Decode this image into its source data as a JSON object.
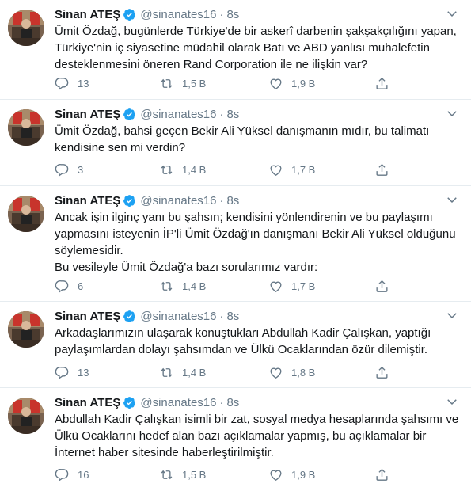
{
  "author": {
    "name": "Sinan ATEŞ",
    "handle": "@sinanates16",
    "dot": "·",
    "time": "8s"
  },
  "tweets": [
    {
      "lines": [
        "Ümit Özdağ, bugünlerde Türkiye'de bir askerî darbenin şakşakçılığını yapan,",
        "Türkiye'nin iç siyasetine müdahil olarak Batı ve ABD yanlısı muhalefetin",
        "desteklenmesini öneren Rand Corporation ile ne ilişkin var?"
      ],
      "replies": "13",
      "retweets": "1,5 B",
      "likes": "1,9 B"
    },
    {
      "lines": [
        "Ümit Özdağ, bahsi geçen Bekir Ali Yüksel danışmanın mıdır, bu talimatı",
        "kendisine sen mi verdin?"
      ],
      "replies": "3",
      "retweets": "1,4 B",
      "likes": "1,7 B"
    },
    {
      "lines": [
        "Ancak işin ilginç yanı bu şahsın; kendisini yönlendirenin ve bu paylaşımı",
        "yapmasını isteyenin İP'li Ümit Özdağ'ın danışmanı Bekir Ali Yüksel olduğunu",
        "söylemesidir.",
        "Bu vesileyle Ümit Özdağ'a bazı sorularımız vardır:"
      ],
      "replies": "6",
      "retweets": "1,4 B",
      "likes": "1,7 B"
    },
    {
      "lines": [
        "Arkadaşlarımızın ulaşarak konuştukları Abdullah Kadir Çalışkan, yaptığı",
        "paylaşımlardan dolayı şahsımdan ve Ülkü Ocaklarından özür dilemiştir."
      ],
      "replies": "13",
      "retweets": "1,4 B",
      "likes": "1,8 B"
    },
    {
      "lines": [
        "Abdullah Kadir Çalışkan isimli bir zat, sosyal medya hesaplarında şahsımı ve",
        "Ülkü Ocaklarını hedef alan bazı açıklamalar yapmış, bu açıklamalar bir",
        "İnternet haber sitesinde haberleştirilmiştir."
      ],
      "replies": "16",
      "retweets": "1,5 B",
      "likes": "1,9 B"
    }
  ],
  "colors": {
    "name": "#14171a",
    "meta": "#657786",
    "verified": "#1da1f2",
    "divider": "#e6ecf0"
  },
  "icons": [
    "verified-badge-icon",
    "chevron-down-icon",
    "reply-icon",
    "retweet-icon",
    "like-icon",
    "share-icon"
  ]
}
